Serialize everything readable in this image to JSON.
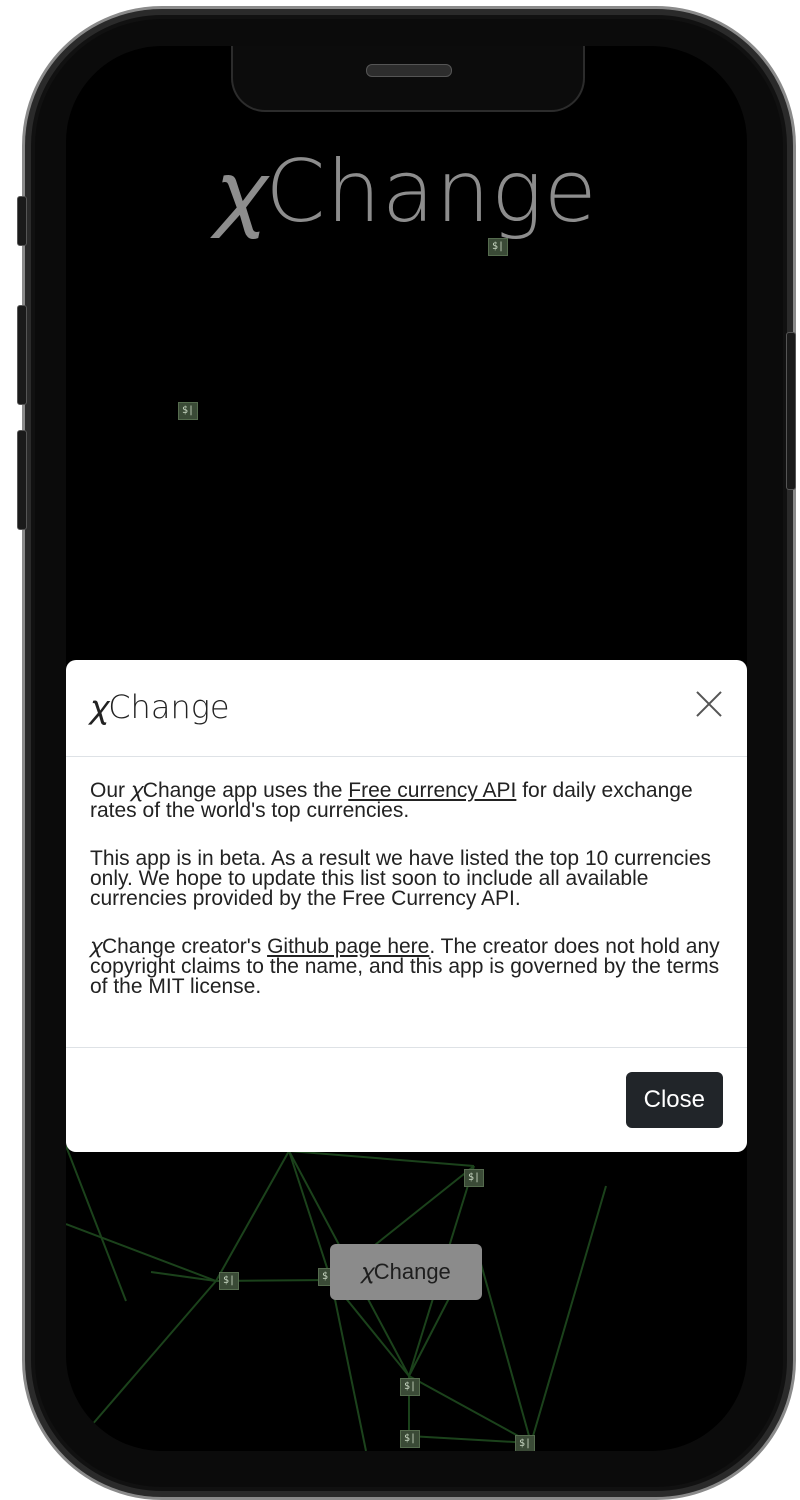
{
  "app": {
    "brand_title": "𝜒Change"
  },
  "chips": [
    "$|",
    "$|",
    "$|",
    "$|",
    "$|",
    "$|",
    "$|",
    "$|"
  ],
  "modal": {
    "title": "𝜒Change",
    "close_label": "Close",
    "p1_prefix": "Our ",
    "p1_brand": "𝜒Change",
    "p1_mid": " app uses the ",
    "p1_link": "Free currency API",
    "p1_suffix": " for daily exchange rates of the world's top currencies.",
    "p2": "This app is in beta. As a result we have listed the top 10 currencies only. We hope to update this list soon to include all available currencies provided by the Free Currency API.",
    "p3_brand": "𝜒Change",
    "p3_mid": " creator's ",
    "p3_link": "Github page here",
    "p3_suffix": ". The creator does not hold any copyright claims to the name, and this app is governed by the terms of the MIT license."
  },
  "fab": {
    "label": "𝜒Change"
  }
}
